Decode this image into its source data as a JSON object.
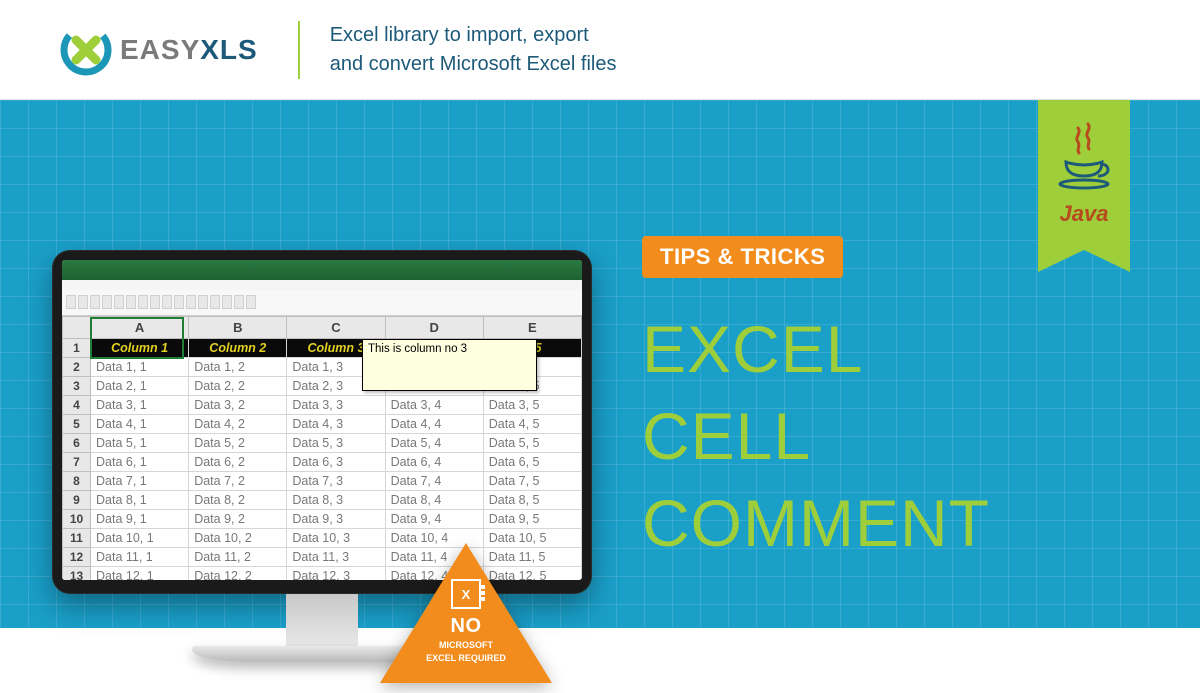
{
  "logo": {
    "part1": "EASY",
    "part2": "XLS"
  },
  "tagline": {
    "line1": "Excel library to import, export",
    "line2": "and convert Microsoft Excel files"
  },
  "ribbon": {
    "label": "Java"
  },
  "tips_label": "TIPS & TRICKS",
  "title": {
    "l1": "EXCEL",
    "l2": "CELL",
    "l3": "COMMENT"
  },
  "badge": {
    "x": "X",
    "no": "NO",
    "sub1": "MICROSOFT",
    "sub2": "EXCEL REQUIRED"
  },
  "comment_text": "This is column no 3",
  "col_letters": [
    "A",
    "B",
    "C",
    "D",
    "E"
  ],
  "headers": [
    "Column 1",
    "Column 2",
    "Column 3",
    "",
    "n 5"
  ],
  "rows": [
    {
      "n": "2",
      "c": [
        "Data 1, 1",
        "Data 1, 2",
        "Data 1, 3",
        "",
        "..."
      ]
    },
    {
      "n": "3",
      "c": [
        "Data 2, 1",
        "Data 2, 2",
        "Data 2, 3",
        "",
        "Data 3, 5"
      ]
    },
    {
      "n": "4",
      "c": [
        "Data 3, 1",
        "Data 3, 2",
        "Data 3, 3",
        "Data 3, 4",
        "Data 3, 5"
      ]
    },
    {
      "n": "5",
      "c": [
        "Data 4, 1",
        "Data 4, 2",
        "Data 4, 3",
        "Data 4, 4",
        "Data 4, 5"
      ]
    },
    {
      "n": "6",
      "c": [
        "Data 5, 1",
        "Data 5, 2",
        "Data 5, 3",
        "Data 5, 4",
        "Data 5, 5"
      ]
    },
    {
      "n": "7",
      "c": [
        "Data 6, 1",
        "Data 6, 2",
        "Data 6, 3",
        "Data 6, 4",
        "Data 6, 5"
      ]
    },
    {
      "n": "8",
      "c": [
        "Data 7, 1",
        "Data 7, 2",
        "Data 7, 3",
        "Data 7, 4",
        "Data 7, 5"
      ]
    },
    {
      "n": "9",
      "c": [
        "Data 8, 1",
        "Data 8, 2",
        "Data 8, 3",
        "Data 8, 4",
        "Data 8, 5"
      ]
    },
    {
      "n": "10",
      "c": [
        "Data 9, 1",
        "Data 9, 2",
        "Data 9, 3",
        "Data 9, 4",
        "Data 9, 5"
      ]
    },
    {
      "n": "11",
      "c": [
        "Data 10, 1",
        "Data 10, 2",
        "Data 10, 3",
        "Data 10, 4",
        "Data 10, 5"
      ]
    },
    {
      "n": "12",
      "c": [
        "Data 11, 1",
        "Data 11, 2",
        "Data 11, 3",
        "Data 11, 4",
        "Data 11, 5"
      ]
    },
    {
      "n": "13",
      "c": [
        "Data 12, 1",
        "Data 12, 2",
        "Data 12, 3",
        "Data 12, 4",
        "Data 12, 5"
      ]
    }
  ]
}
